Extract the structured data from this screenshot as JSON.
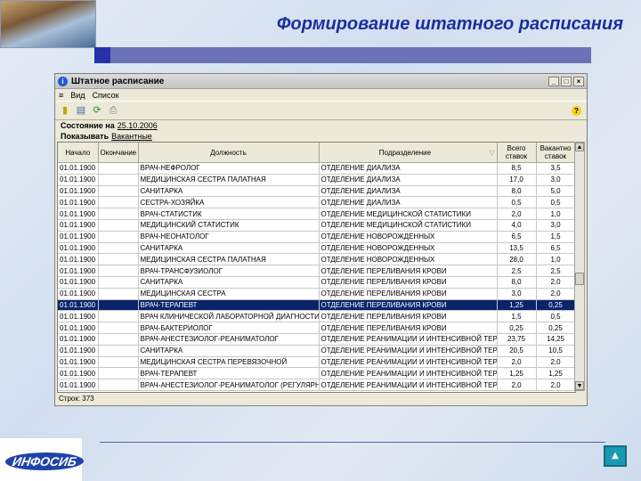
{
  "slide": {
    "title": "Формирование штатного расписания",
    "thumb_caption": "",
    "logo_text": "ИНФОСИБ"
  },
  "window": {
    "title": "Штатное расписание",
    "menu": [
      "Вид",
      "Список"
    ],
    "state_label": "Состояние на",
    "state_date": "25.10.2006",
    "show_label": "Показывать",
    "show_value": "Вакантные",
    "status": "Строк: 373"
  },
  "table": {
    "columns": [
      "Начало",
      "Окончание",
      "Должность",
      "Подразделение",
      "Всего ставок",
      "Вакантно ставок"
    ],
    "rows": [
      [
        "01.01.1900",
        "",
        "ВРАЧ-НЕФРОЛОГ",
        "ОТДЕЛЕНИЕ ДИАЛИЗА",
        "8,5",
        "3,5"
      ],
      [
        "01.01.1900",
        "",
        "МЕДИЦИНСКАЯ СЕСТРА ПАЛАТНАЯ",
        "ОТДЕЛЕНИЕ ДИАЛИЗА",
        "17,0",
        "3,0"
      ],
      [
        "01.01.1900",
        "",
        "САНИТАРКА",
        "ОТДЕЛЕНИЕ ДИАЛИЗА",
        "8,0",
        "5,0"
      ],
      [
        "01.01.1900",
        "",
        "СЕСТРА-ХОЗЯЙКА",
        "ОТДЕЛЕНИЕ ДИАЛИЗА",
        "0,5",
        "0,5"
      ],
      [
        "01.01.1900",
        "",
        "ВРАЧ-СТАТИСТИК",
        "ОТДЕЛЕНИЕ МЕДИЦИНСКОЙ СТАТИСТИКИ",
        "2,0",
        "1,0"
      ],
      [
        "01.01.1900",
        "",
        "МЕДИЦИНСКИЙ СТАТИСТИК",
        "ОТДЕЛЕНИЕ МЕДИЦИНСКОЙ СТАТИСТИКИ",
        "4,0",
        "3,0"
      ],
      [
        "01.01.1900",
        "",
        "ВРАЧ-НЕОНАТОЛОГ",
        "ОТДЕЛЕНИЕ НОВОРОЖДЕННЫХ",
        "6,5",
        "1,5"
      ],
      [
        "01.01.1900",
        "",
        "САНИТАРКА",
        "ОТДЕЛЕНИЕ НОВОРОЖДЕННЫХ",
        "13,5",
        "6,5"
      ],
      [
        "01.01.1900",
        "",
        "МЕДИЦИНСКАЯ СЕСТРА ПАЛАТНАЯ",
        "ОТДЕЛЕНИЕ НОВОРОЖДЕННЫХ",
        "28,0",
        "1,0"
      ],
      [
        "01.01.1900",
        "",
        "ВРАЧ-ТРАНСФУЗИОЛОГ",
        "ОТДЕЛЕНИЕ ПЕРЕЛИВАНИЯ КРОВИ",
        "2,5",
        "2,5"
      ],
      [
        "01.01.1900",
        "",
        "САНИТАРКА",
        "ОТДЕЛЕНИЕ ПЕРЕЛИВАНИЯ КРОВИ",
        "8,0",
        "2,0"
      ],
      [
        "01.01.1900",
        "",
        "МЕДИЦИНСКАЯ СЕСТРА",
        "ОТДЕЛЕНИЕ ПЕРЕЛИВАНИЯ КРОВИ",
        "3,0",
        "2,0"
      ],
      [
        "01.01.1900",
        "",
        "ВРАЧ-ТЕРАПЕВТ",
        "ОТДЕЛЕНИЕ ПЕРЕЛИВАНИЯ КРОВИ",
        "1,25",
        "0,25"
      ],
      [
        "01.01.1900",
        "",
        "ВРАЧ КЛИНИЧЕСКОЙ ЛАБОРАТОРНОЙ ДИАГНОСТИКИ",
        "ОТДЕЛЕНИЕ ПЕРЕЛИВАНИЯ КРОВИ",
        "1,5",
        "0,5"
      ],
      [
        "01.01.1900",
        "",
        "ВРАЧ-БАКТЕРИОЛОГ",
        "ОТДЕЛЕНИЕ ПЕРЕЛИВАНИЯ КРОВИ",
        "0,25",
        "0,25"
      ],
      [
        "01.01.1900",
        "",
        "ВРАЧ-АНЕСТЕЗИОЛОГ-РЕАНИМАТОЛОГ",
        "ОТДЕЛЕНИЕ РЕАНИМАЦИИ И ИНТЕНСИВНОЙ ТЕРАПИИ",
        "23,75",
        "14,25"
      ],
      [
        "01.01.1900",
        "",
        "САНИТАРКА",
        "ОТДЕЛЕНИЕ РЕАНИМАЦИИ И ИНТЕНСИВНОЙ ТЕРАПИИ",
        "20,5",
        "10,5"
      ],
      [
        "01.01.1900",
        "",
        "МЕДИЦИНСКАЯ СЕСТРА ПЕРЕВЯЗОЧНОЙ",
        "ОТДЕЛЕНИЕ РЕАНИМАЦИИ И ИНТЕНСИВНОЙ ТЕРАПИИ",
        "2,0",
        "2,0"
      ],
      [
        "01.01.1900",
        "",
        "ВРАЧ-ТЕРАПЕВТ",
        "ОТДЕЛЕНИЕ РЕАНИМАЦИИ И ИНТЕНСИВНОЙ ТЕРАПИИ",
        "1,25",
        "1,25"
      ],
      [
        "01.01.1900",
        "",
        "ВРАЧ-АНЕСТЕЗИОЛОГ-РЕАНИМАТОЛОГ (РЕГУЛЯРНЫЙ)",
        "ОТДЕЛЕНИЕ РЕАНИМАЦИИ И ИНТЕНСИВНОЙ ТЕРАПИИ",
        "2,0",
        "2,0"
      ]
    ],
    "selected_row": 12
  },
  "icons": {
    "window": "info-icon",
    "menu": "hamburger-icon",
    "toolbar": [
      "exit-icon",
      "card-icon",
      "refresh-icon",
      "print-icon",
      "help-icon"
    ],
    "nav": "home-icon"
  },
  "colors": {
    "title": "#1a2fa0",
    "selection": "#0a246a",
    "accent_bar": "#6b72b8"
  }
}
